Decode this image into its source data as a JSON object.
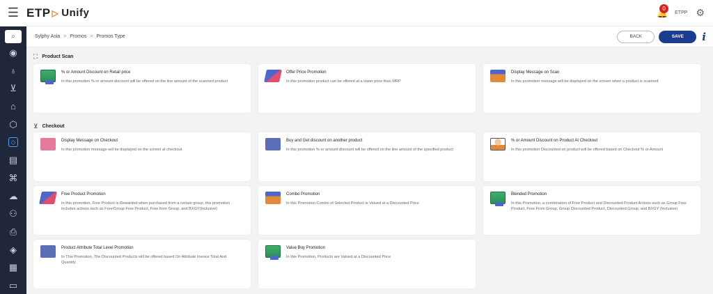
{
  "topbar": {
    "logo_main": "ETP",
    "logo_sub": "Unify",
    "notification_count": "0",
    "user": "ETPP"
  },
  "breadcrumb": {
    "items": [
      "Sylphy Asia",
      "Promos",
      "Promos Type"
    ],
    "separator": ">"
  },
  "actions": {
    "back_label": "BACK",
    "save_label": "SAVE",
    "info_label": "i"
  },
  "sections": {
    "product_scan": "Product Scan",
    "checkout": "Checkout"
  },
  "cards": [
    {
      "title": "% or Amount Discount on Retail price",
      "desc": "In this promotion % or amount discount will be offered on the line amount of the scanned product",
      "icon": "cash-icon"
    },
    {
      "title": "Offer Price Promotion",
      "desc": "In this promotion product can be offered at a lower price than MRP",
      "icon": "price-tag-icon"
    },
    {
      "title": "Display Message on Scan",
      "desc": "In this promotion message will be displayed on the screen when a product is scanned",
      "icon": "percent-icon"
    },
    {
      "title": "Display Message on Checkout",
      "desc": "In this promotion message will be displayed on the screen at checkout",
      "icon": "discount-tag-icon"
    },
    {
      "title": "Buy and Get discount on another product",
      "desc": "In this promotion % or amount discount will be offered on the line amount of the specified product",
      "icon": "truck-icon"
    },
    {
      "title": "% or Amount Discount on Product At Checkout",
      "desc": "In this promotion Discounted on product will be offered based on Checkout % or Amount",
      "icon": "person-discount-icon"
    },
    {
      "title": "Free Product Promotion",
      "desc": "In this promotion, Free Product is Rewarded when purchased from a certain group, this promotion includes actions such as Free/Group Free Product, Free from Group, and BXGY(Inclusive)",
      "icon": "price-tag-icon"
    },
    {
      "title": "Combo Promotion",
      "desc": "In this Promotion Combo of Selected Product is Valued at a Discounted Price",
      "icon": "percent-icon"
    },
    {
      "title": "Blended Promotion",
      "desc": "In this Promotion, a combination of Free Product and Discounted Product Actions such as Group Free Product, Free From Group, Group Discounted Product, Discounted Group, and BXGY (Inclusive)",
      "icon": "cash-icon"
    },
    {
      "title": "Product Attribute Total Level Promotion",
      "desc": "In This Promotion, The Discounted Products will be offered based On Attribute Invoice Total And Quantity",
      "icon": "truck-icon"
    },
    {
      "title": "Value Buy Promotion",
      "desc": "In this Promotion, Products are Valued at a Discounted Price",
      "icon": "cash-icon"
    }
  ],
  "colors": {
    "sidebar": "#20273a",
    "save_button": "#1a3d8f",
    "accent": "#4aa3ff",
    "badge": "#e02020"
  }
}
